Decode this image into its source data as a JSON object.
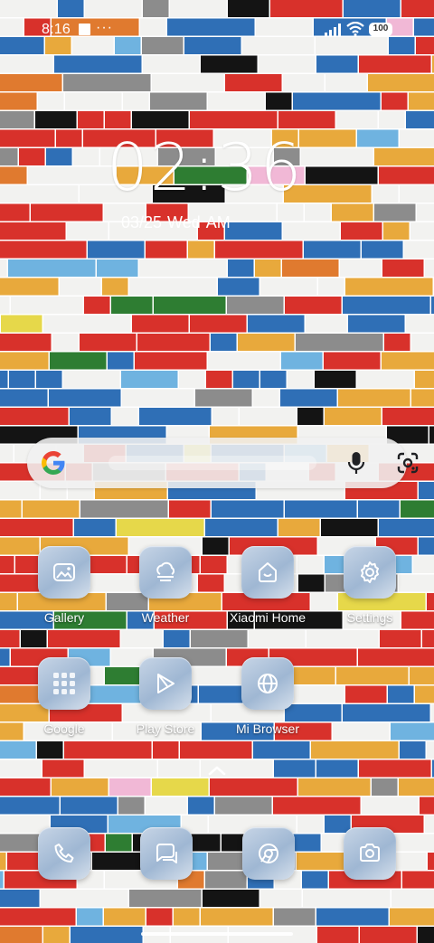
{
  "status_bar": {
    "time": "8:16",
    "dots": "···",
    "battery": "100"
  },
  "lockscreen": {
    "clock": "02:36",
    "date": "03/25",
    "weekday": "Wed",
    "ampm": "AM"
  },
  "search_bar": {
    "icons": [
      "google-icon",
      "mic-icon",
      "google-lens-icon"
    ]
  },
  "apps": [
    {
      "label": "Gallery",
      "icon": "gallery-icon"
    },
    {
      "label": "Weather",
      "icon": "weather-icon"
    },
    {
      "label": "Xiaomi Home",
      "icon": "xiaomi-home-icon"
    },
    {
      "label": "Settings",
      "icon": "gear-icon"
    },
    {
      "label": "Google",
      "icon": "google-folder-icon"
    },
    {
      "label": "Play Store",
      "icon": "play-store-icon"
    },
    {
      "label": "Mi Browser",
      "icon": "globe-icon"
    }
  ],
  "dock": [
    {
      "icon": "phone-icon"
    },
    {
      "icon": "messages-icon"
    },
    {
      "icon": "chrome-icon"
    },
    {
      "icon": "camera-icon"
    }
  ],
  "colors": {
    "tile_start": "#c7d5e6",
    "tile_end": "#9fb7d3",
    "icon_stroke": "#ffffff",
    "brick_palette": [
      "#d8312b",
      "#2f6fb6",
      "#f2f2f0",
      "#e8a93c",
      "#141414",
      "#8c8c8c",
      "#2e7d32",
      "#6fb3e0",
      "#e07a2f",
      "#e6d84a",
      "#f1b8d6"
    ]
  }
}
